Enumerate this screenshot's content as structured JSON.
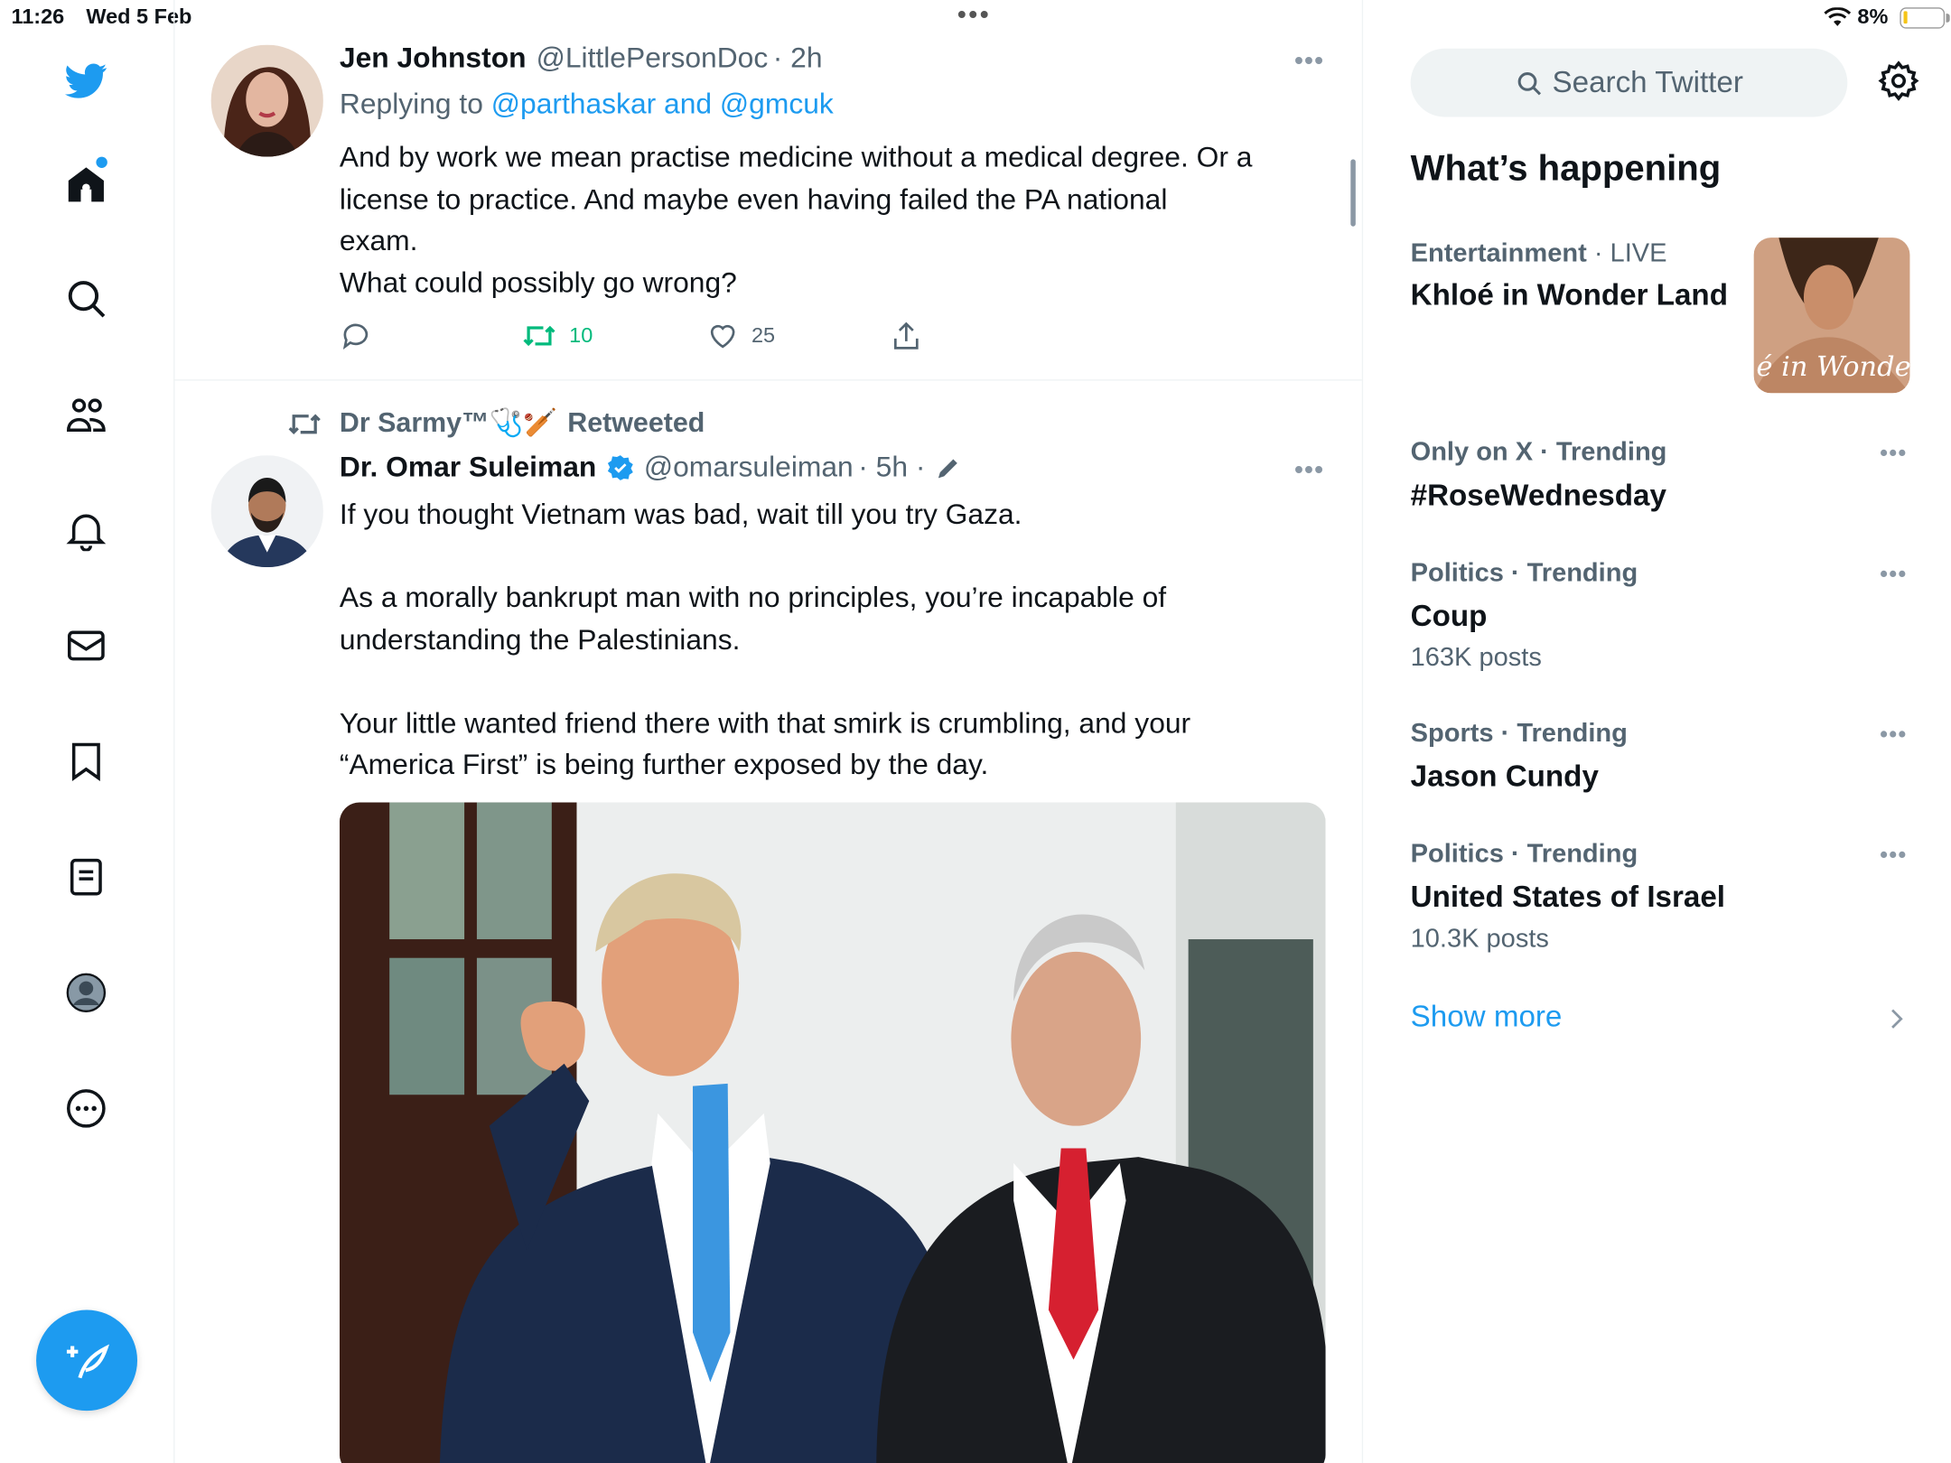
{
  "status_bar": {
    "time": "11:26",
    "date": "Wed 5 Feb",
    "battery": "8%"
  },
  "sidebar": {
    "items": [
      "twitter-logo",
      "home",
      "explore",
      "communities",
      "notifications",
      "messages",
      "bookmarks",
      "lists",
      "profile",
      "more"
    ]
  },
  "tweet1": {
    "name": "Jen Johnston",
    "handle": "@LittlePersonDoc",
    "time": "· 2h",
    "replying_prefix": "Replying to ",
    "replying_to": "@parthaskar and @gmcuk",
    "text_lines": [
      "And by work we mean practise medicine without a medical degree. Or a",
      "license to practice. And maybe even having failed the PA national",
      "exam.",
      "What could possibly go wrong?"
    ],
    "retweets": "10",
    "likes": "25"
  },
  "tweet2": {
    "retweeted_by": "Dr Sarmy™🩺🏏",
    "retweeted_label": "Retweeted",
    "name": "Dr. Omar Suleiman",
    "handle": "@omarsuleiman",
    "time": "· 5h ·",
    "text_lines": [
      "If you thought Vietnam was bad, wait till you try Gaza.",
      "",
      "As a morally bankrupt man with no principles, you’re incapable of",
      "understanding the Palestinians.",
      "",
      "Your little wanted friend there with that smirk is crumbling, and your",
      "“America First” is being further exposed by the day."
    ]
  },
  "right": {
    "search_placeholder": "Search Twitter",
    "whats_happening": "What’s happening",
    "trends": [
      {
        "category": "Entertainment",
        "tag": "· LIVE",
        "title": "Khloé in Wonder Land",
        "count": ""
      },
      {
        "category": "Only on X · Trending",
        "tag": "",
        "title": "#RoseWednesday",
        "count": ""
      },
      {
        "category": "Politics · Trending",
        "tag": "",
        "title": "Coup",
        "count": "163K posts"
      },
      {
        "category": "Sports · Trending",
        "tag": "",
        "title": "Jason Cundy",
        "count": ""
      },
      {
        "category": "Politics · Trending",
        "tag": "",
        "title": "United States of Israel",
        "count": "10.3K posts"
      }
    ],
    "trend_image_text": "é in Wonder L",
    "show_more": "Show more"
  },
  "colors": {
    "accent": "#1d9bf0",
    "retweet": "#00ba7c",
    "muted": "#536471"
  }
}
